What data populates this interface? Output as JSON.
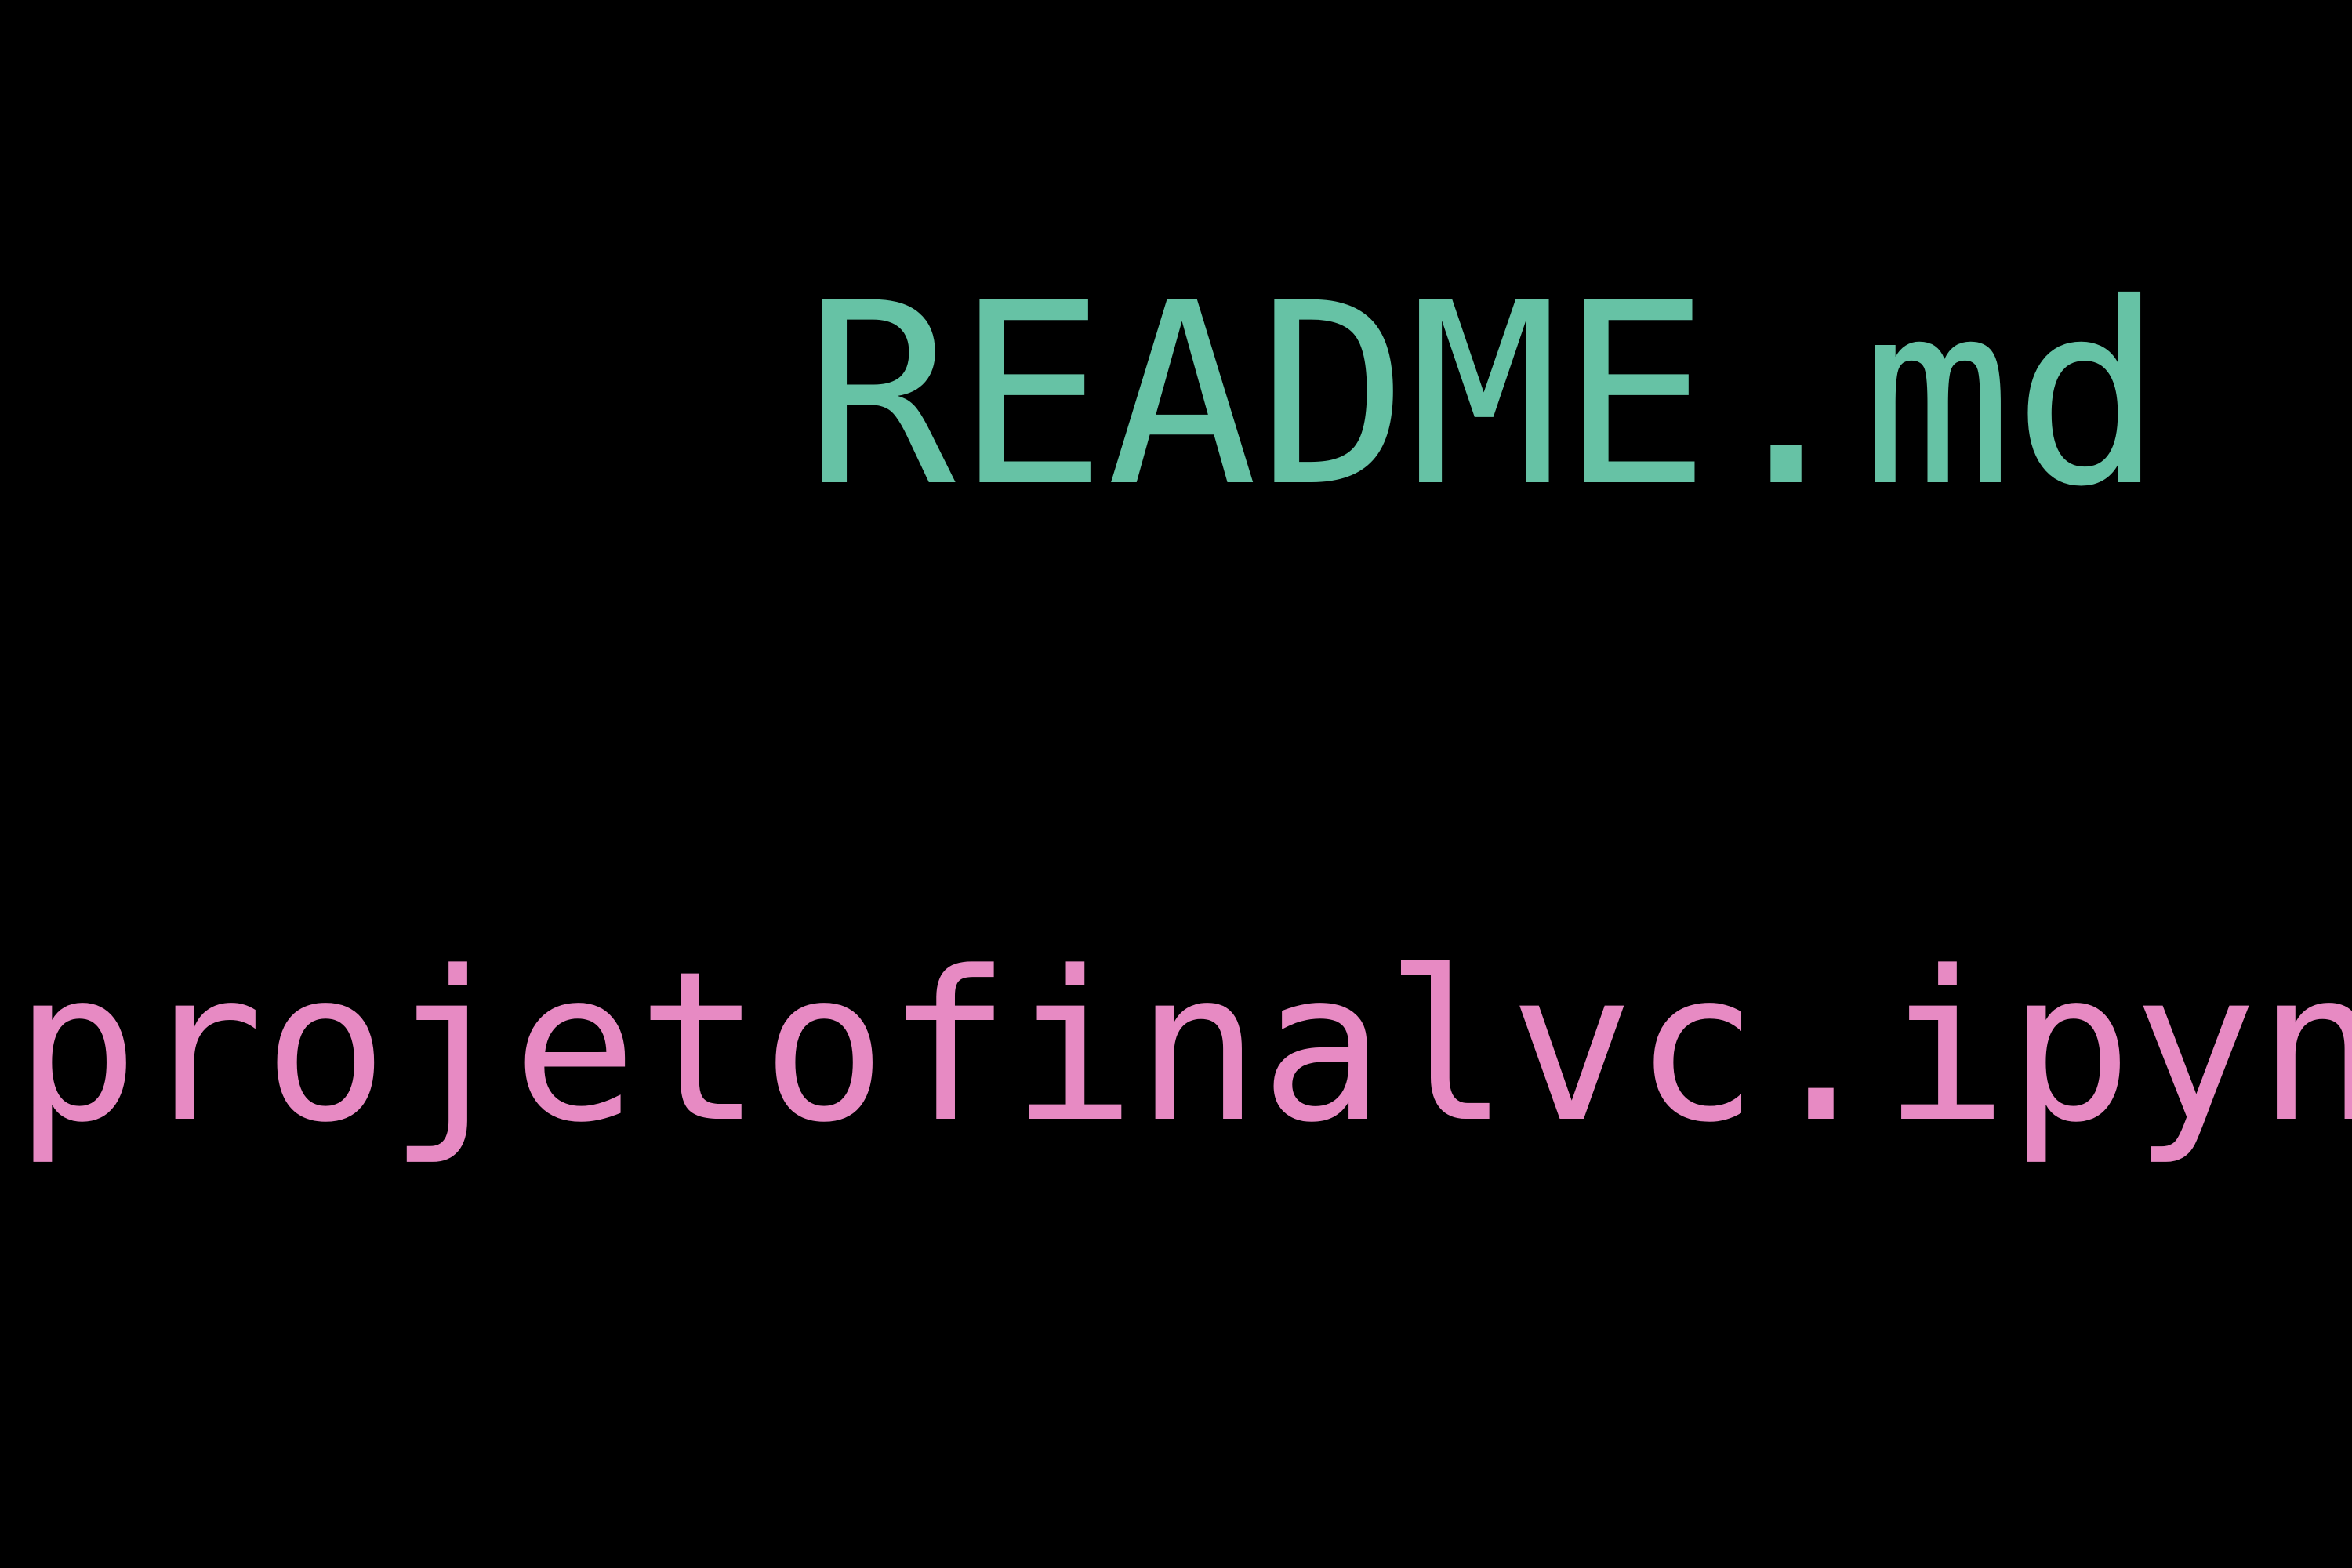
{
  "background_color": "#000000",
  "words": [
    {
      "text": "README.md",
      "color": "#66c2a5"
    },
    {
      "text": "projetofinalvc.ipynb",
      "color": "#e78ac3"
    }
  ]
}
